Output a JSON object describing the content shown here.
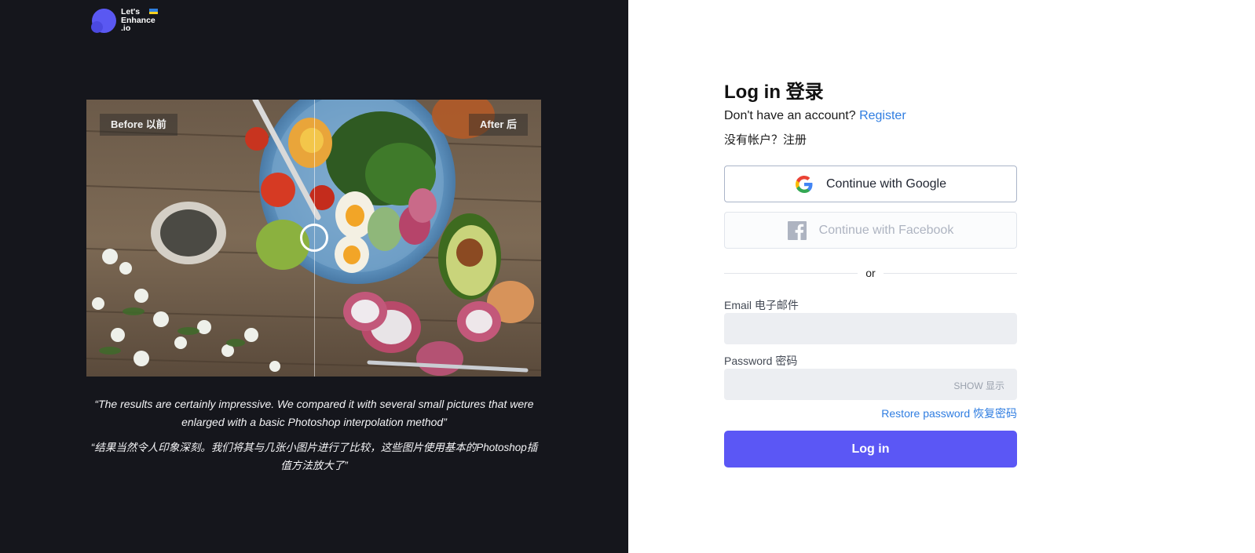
{
  "brand": {
    "name_line1": "Let's",
    "name_line2": "Enhance",
    "name_line3": ".io",
    "logo_color": "#5a58f2"
  },
  "comparison": {
    "before_label": "Before 以前",
    "after_label": "After 后",
    "image_subject": "salad bowl with vegetables on wooden table"
  },
  "testimonial": {
    "quote_en": "“The results are certainly impressive. We compared it with several small pictures that were enlarged with a basic Photoshop interpolation method”",
    "quote_zh": "“结果当然令人印象深刻。我们将其与几张小图片进行了比较，这些图片使用基本的Photoshop插值方法放大了”"
  },
  "login": {
    "title": "Log in 登录",
    "no_account_text": "Don't have an account?",
    "register_link": "Register",
    "no_account_zh": "没有帐户？注册",
    "google_button": "Continue with Google",
    "facebook_button": "Continue with Facebook",
    "or_text": "or",
    "email_label": "Email 电子邮件",
    "email_value": "",
    "password_label": "Password 密码",
    "password_value": "",
    "show_label": "SHOW 显示",
    "restore_link": "Restore password 恢复密码",
    "login_button": "Log in",
    "accent_color": "#5b57f5",
    "link_color": "#2f7de1"
  }
}
